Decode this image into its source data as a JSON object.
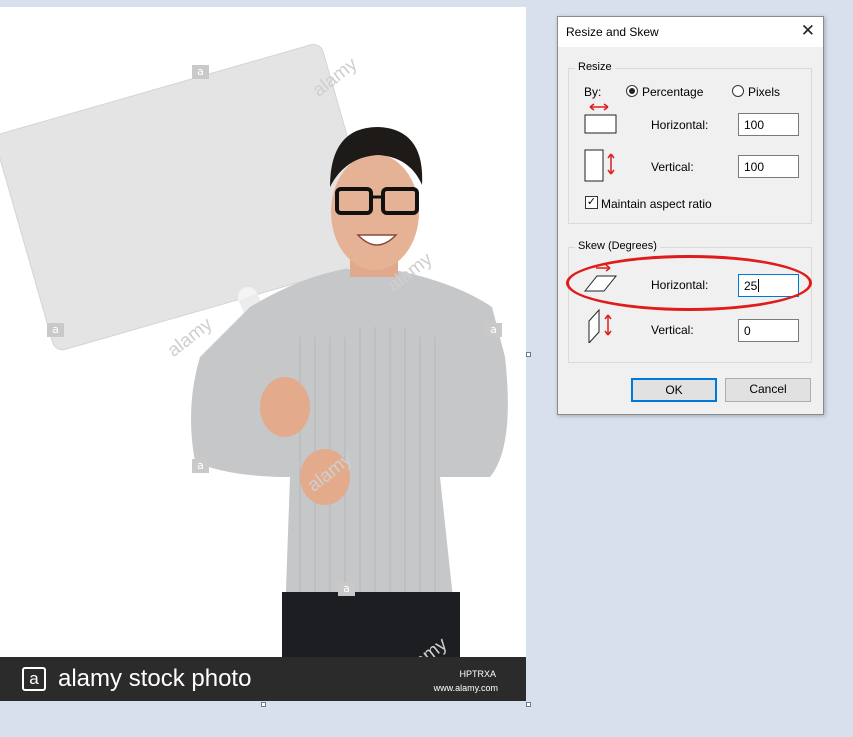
{
  "photo": {
    "watermark_letter": "a",
    "watermark_text": "alamy",
    "footer_logo": "a",
    "footer_brand": "alamy stock photo",
    "image_code": "HPTRXA",
    "site_url": "www.alamy.com"
  },
  "dialog": {
    "title": "Resize and Skew",
    "close_glyph": "✕",
    "resize": {
      "legend": "Resize",
      "by_label": "By:",
      "percentage_label": "Percentage",
      "pixels_label": "Pixels",
      "selected": "Percentage",
      "horizontal_label": "Horizontal:",
      "horizontal_value": "100",
      "vertical_label": "Vertical:",
      "vertical_value": "100",
      "maintain_label": "Maintain aspect ratio",
      "maintain_checked": "✓"
    },
    "skew": {
      "legend": "Skew (Degrees)",
      "horizontal_label": "Horizontal:",
      "horizontal_value": "25",
      "vertical_label": "Vertical:",
      "vertical_value": "0"
    },
    "ok_label": "OK",
    "cancel_label": "Cancel"
  },
  "colors": {
    "annotation": "#e01b1b",
    "accent": "#0078d7",
    "icon_arrow": "#d9201d"
  }
}
